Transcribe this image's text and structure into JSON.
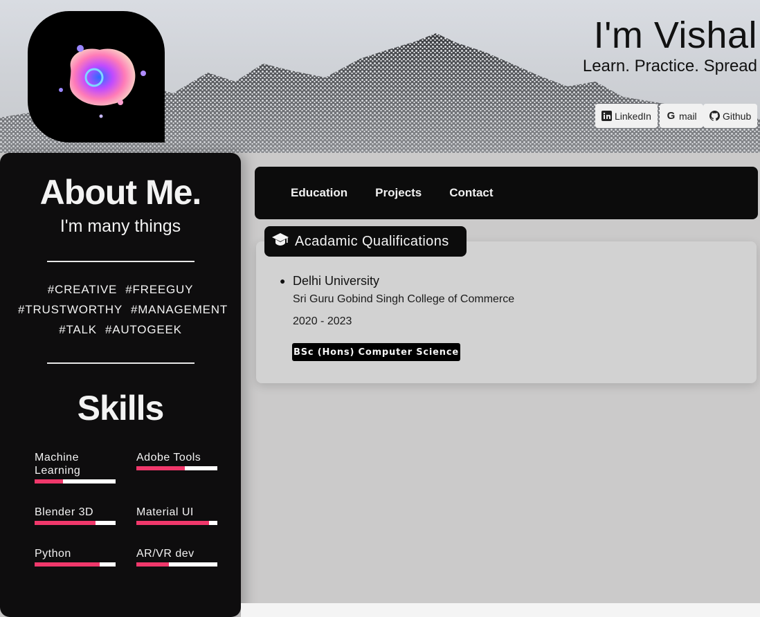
{
  "header": {
    "title": "I'm Vishal",
    "tagline": "Learn. Practice. Spread",
    "social": [
      {
        "label": "LinkedIn",
        "icon": "linkedin-icon"
      },
      {
        "label": "mail",
        "icon": "google-icon"
      },
      {
        "label": "Github",
        "icon": "github-icon"
      }
    ]
  },
  "about": {
    "title": "About Me.",
    "subtitle": "I'm many things",
    "tags": [
      "#CREATIVE",
      "#FREEGUY",
      "#TRUSTWORTHY",
      "#MANAGEMENT",
      "#TALK",
      "#AUTOGEEK"
    ]
  },
  "skills": {
    "title": "Skills",
    "items": [
      {
        "label": "Machine Learning",
        "level": 0.35
      },
      {
        "label": "Adobe Tools",
        "level": 0.6
      },
      {
        "label": "Blender 3D",
        "level": 0.75
      },
      {
        "label": "Material UI",
        "level": 0.9
      },
      {
        "label": "Python",
        "level": 0.8
      },
      {
        "label": "AR/VR dev",
        "level": 0.4
      }
    ],
    "bar_color": "#f0386b"
  },
  "nav": {
    "items": [
      "Education",
      "Projects",
      "Contact"
    ]
  },
  "education": {
    "heading": "Acadamic Qualifications",
    "heading_icon": "graduation-cap-icon",
    "university": "Delhi University",
    "college": "Sri Guru Gobind Singh College of Commerce",
    "years": "2020 - 2023",
    "degree": "BSc (Hons) Computer Science"
  }
}
